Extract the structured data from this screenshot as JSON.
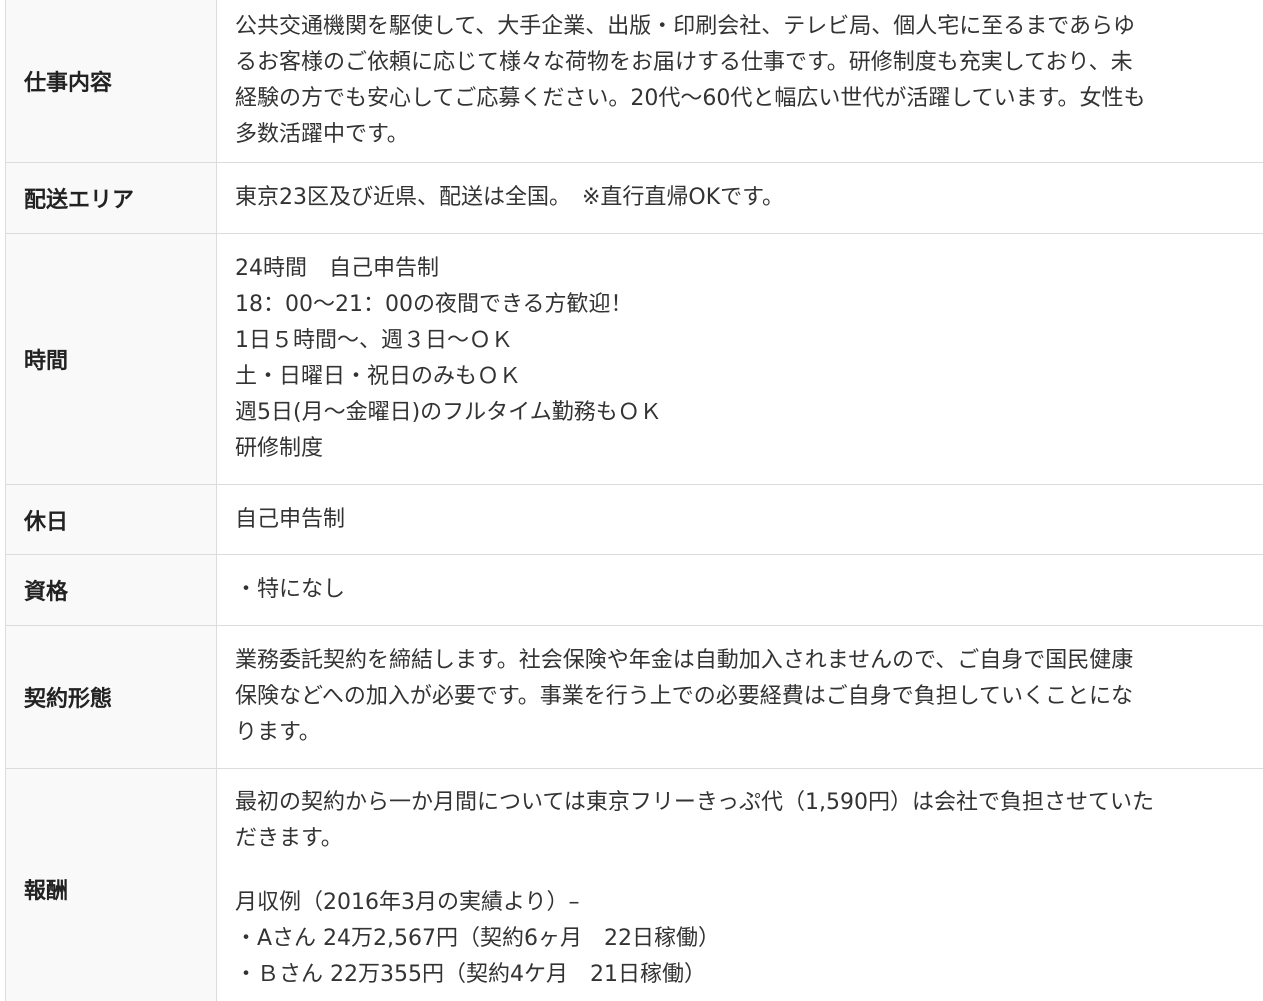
{
  "rows": [
    {
      "label": "仕事内容",
      "lines": [
        "公共交通機関を駆使して、大手企業、出版・印刷会社、テレビ局、個人宅に至るまであらゆ",
        "るお客様のご依頼に応じて様々な荷物をお届けする仕事です。研修制度も充実しており、未",
        "経験の方でも安心してご応募ください。20代～60代と幅広い世代が活躍しています。女性も",
        "多数活躍中です。"
      ]
    },
    {
      "label": "配送エリア",
      "lines": [
        "東京23区及び近県、配送は全国。　※直行直帰OKです。"
      ]
    },
    {
      "label": "時間",
      "lines": [
        "24時間　自己申告制",
        "18：00～21：00の夜間できる方歓迎！",
        "1日５時間～、週３日～ＯＫ",
        "土・日曜日・祝日のみもＯＫ",
        "週5日(月～金曜日)のフルタイム勤務もＯＫ",
        "研修制度"
      ]
    },
    {
      "label": "休日",
      "lines": [
        "自己申告制"
      ]
    },
    {
      "label": "資格",
      "lines": [
        "・特になし"
      ]
    },
    {
      "label": "契約形態",
      "lines": [
        "業務委託契約を締結します。社会保険や年金は自動加入されませんので、ご自身で国民健康",
        "保険などへの加入が必要です。事業を行う上での必要経費はご自身で負担していくことにな",
        "ります。"
      ]
    },
    {
      "label": "報酬",
      "lines": [
        "最初の契約から一か月間については東京フリーきっぷ代（1,590円）は会社で負担させていた",
        "だきます。"
      ],
      "lines2": [
        "月収例（2016年3月の実績より）–",
        "・Aさん 24万2,567円（契約6ヶ月　22日稼働）",
        "・Ｂさん 22万355円（契約4ケ月　21日稼働）"
      ]
    }
  ]
}
